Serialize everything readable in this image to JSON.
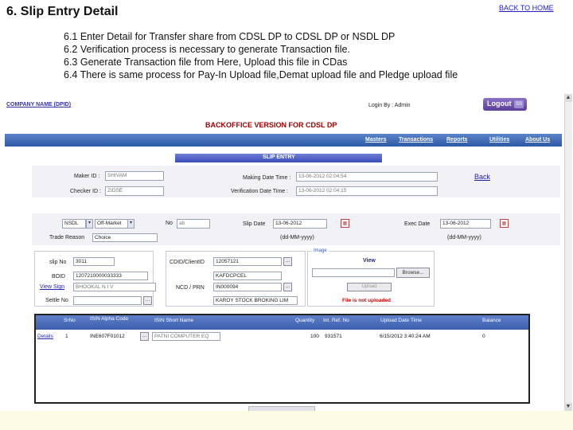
{
  "slide": {
    "title": "6. Slip Entry Detail",
    "back_home": "BACK TO HOME",
    "steps": [
      "6.1 Enter Detail for Transfer share from CDSL DP to CDSL DP or NSDL DP",
      "6.2 Verification process is necessary to generate Transaction file.",
      "6.3 Generate Transaction file from Here, Upload this file in CDas",
      "6.4 There is same process for Pay-In Upload file,Demat upload file and Pledge upload file"
    ]
  },
  "app": {
    "company": "COMPANY NAME (DPID)",
    "login_by": "Login By : Admin",
    "logout": "Logout",
    "logout_icon": "SS",
    "banner": "BACKOFFICE VERSION FOR CDSL DP",
    "menu": [
      "Masters",
      "Transactions",
      "Reports",
      "Utilities",
      "About Us"
    ]
  },
  "slip": {
    "section_title": "SLIP ENTRY",
    "maker_id_label": "Maker ID :",
    "maker_id_value": "SHIVAM",
    "checker_id_label": "Checker ID :",
    "checker_id_value": "ZIDSE",
    "making_dt_label": "Making Date Time :",
    "making_dt_value": "13-06-2012 02:04:54",
    "verif_dt_label": "Verification Date Time :",
    "verif_dt_value": "13-06-2012 02:04:15",
    "back": "Back",
    "depository": "NSDL",
    "market": "Off-Market",
    "no_label": "No",
    "no_value": "ab",
    "slip_date_label": "Slip Date",
    "slip_date_value": "13-06-2012",
    "date_fmt_1": "(dd-MM-yyyy)",
    "exec_date_label": "Exec Date",
    "exec_date_value": "13-06-2012",
    "date_fmt_2": "(dd-MM-yyyy)",
    "trade_reason_label": "Trade Reason",
    "trade_reason_value": "Choice",
    "slip_no_label": "slip No",
    "slip_no_value": "3011",
    "boid_label": "BOID",
    "boid_value": "1207210000033333",
    "view_sign": "View Sign",
    "view_sign_value": "BHOOKAL N I V",
    "settle_no_label": "Settle No",
    "cdid_label": "CDID/ClientID",
    "cdid_value": "12057121",
    "cdid_value2": "KAFDCPCEL",
    "ncd_label": "NCD / PRN",
    "ncd_value": "IN000094",
    "ncd_value2": "KAROY STOCK BROKING LIM",
    "image_legend": "Image",
    "view": "View",
    "browse": "Browse...",
    "upload": "Upload",
    "file_status": "File is not uploaded"
  },
  "grid": {
    "columns": [
      "SrNo",
      "ISIN Alpha Code",
      "ISIN Short Name",
      "Quantity",
      "Int. Ref. No",
      "Upload Date Time",
      "Balance"
    ],
    "rows": [
      {
        "action": "Details",
        "srno": "1",
        "isin": "INE607F01012",
        "short_name": "PATNI COMPUTER EQ",
        "quantity": "100",
        "int_ref": "931571",
        "upload_dt": "6/15/2012 3:40:24 AM",
        "balance": "0"
      }
    ]
  }
}
